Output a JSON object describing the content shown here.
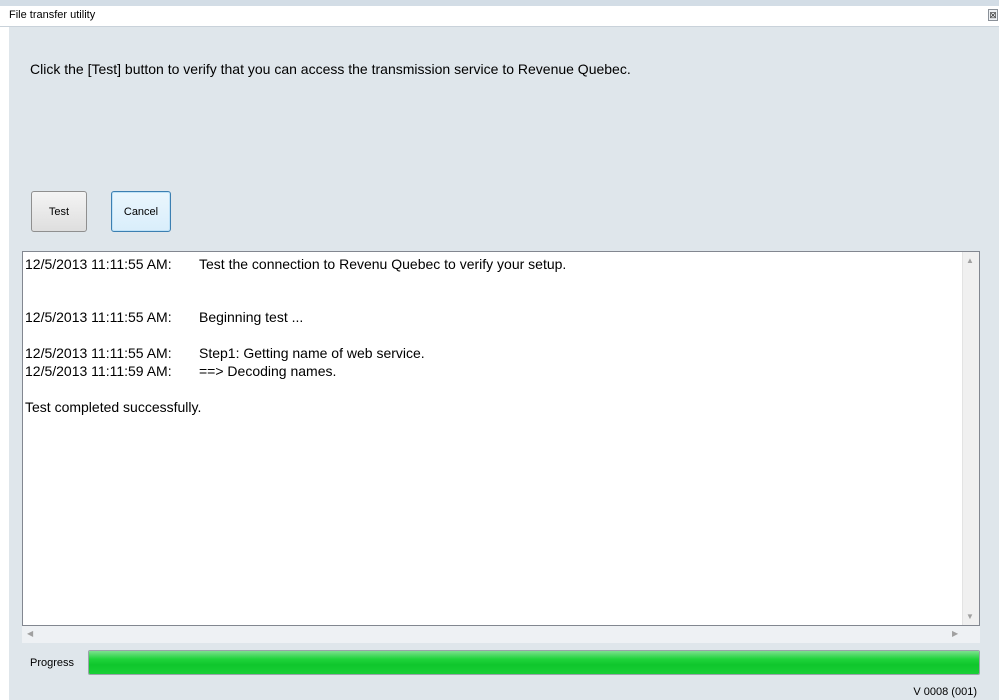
{
  "window": {
    "title": "File transfer utility",
    "close_glyph": "⊠"
  },
  "instruction": "Click the [Test] button to verify that you can access the transmission service to Revenue Quebec.",
  "buttons": {
    "test": "Test",
    "cancel": "Cancel"
  },
  "log": [
    {
      "time": "12/5/2013 11:11:55 AM:",
      "message": "Test the connection to Revenu Quebec to verify your setup."
    },
    {
      "time": "12/5/2013 11:11:55 AM:",
      "message": "Beginning test ..."
    },
    {
      "time": "12/5/2013 11:11:55 AM:",
      "message": "Step1: Getting name of web service."
    },
    {
      "time": "12/5/2013 11:11:59 AM:",
      "message": "==> Decoding names."
    },
    {
      "time": "",
      "message": "Test completed successfully."
    }
  ],
  "progress": {
    "label": "Progress",
    "value_percent": 100,
    "color": "#0fc62c"
  },
  "version": "V 0008 (001)",
  "icons": {
    "scroll_up": "up-arrow",
    "scroll_down": "down-arrow",
    "scroll_left": "left-arrow",
    "scroll_right": "right-arrow"
  }
}
